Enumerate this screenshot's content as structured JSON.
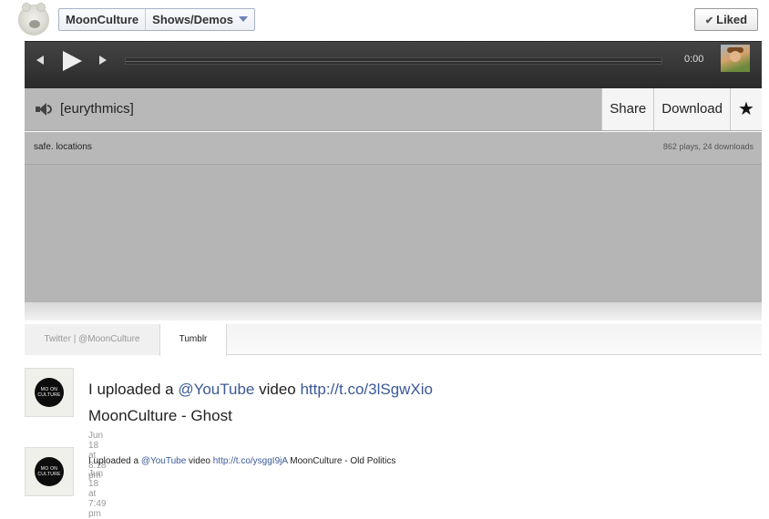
{
  "header": {
    "page_name": "MoonCulture",
    "section": "Shows/Demos",
    "liked_label": "Liked"
  },
  "player": {
    "time": "0:00"
  },
  "track": {
    "title": "[eurythmics]",
    "share_label": "Share",
    "download_label": "Download",
    "star_glyph": "★",
    "artist": "safe. locations",
    "stats": "862 plays, 24 downloads"
  },
  "tabs": [
    {
      "label": "Twitter | @MoonCulture",
      "active": false
    },
    {
      "label": "Tumblr",
      "active": true
    }
  ],
  "avatar_text": [
    "MO ON",
    "CULTURE"
  ],
  "posts": [
    {
      "prefix": "I uploaded a ",
      "mention": "@YouTube",
      "mid": " video ",
      "link": "http://t.co/3lSgwXio",
      "title": "MoonCulture - Ghost",
      "timestamp": "Jun 18 at 8:18 pm"
    },
    {
      "prefix": "I uploaded a ",
      "mention": "@YouTube",
      "mid": " video ",
      "link": "http://t.co/ysggI9jA",
      "title": " MoonCulture - Old Politics",
      "timestamp": "Jun 18 at 7:49 pm"
    }
  ],
  "colors": {
    "link": "#3b5998",
    "player_bg": "#333333",
    "track_bg": "#b8b8b8"
  }
}
